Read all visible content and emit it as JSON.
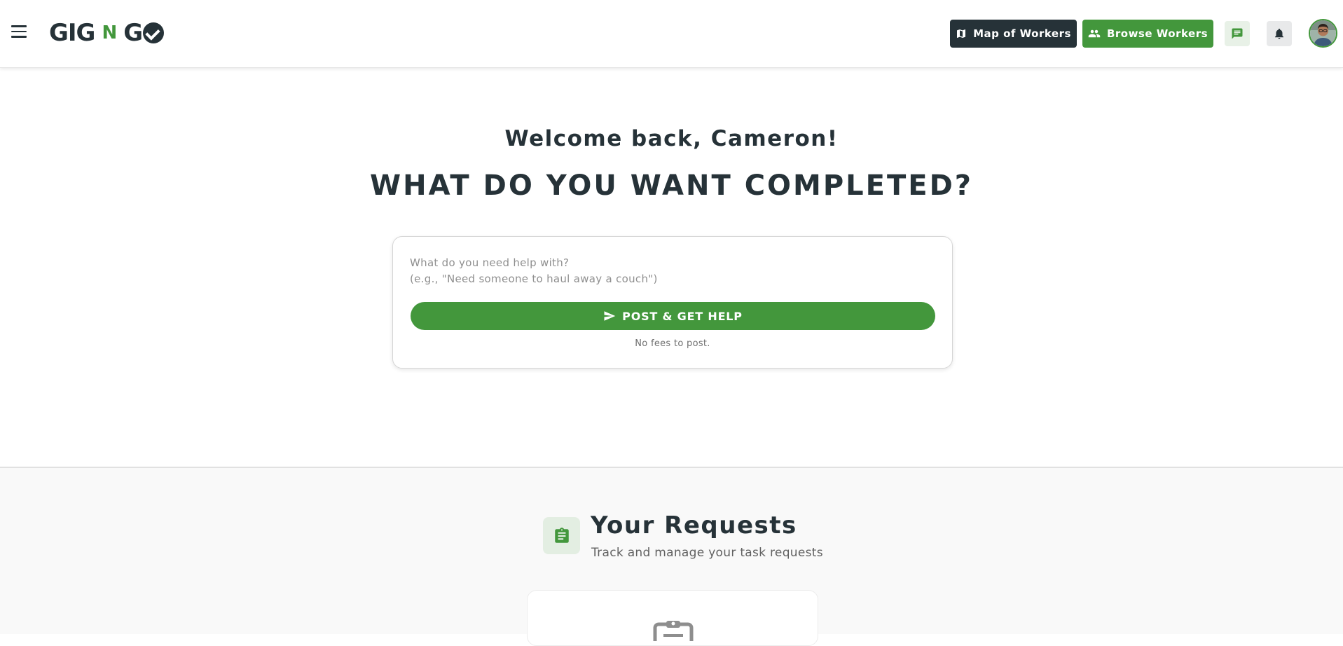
{
  "app": {
    "logo_left": "GIG",
    "logo_mid": "N",
    "logo_right": "G",
    "brand_green": "#43973c",
    "brand_dark": "#263238"
  },
  "header": {
    "map_label": "Map of Workers",
    "browse_label": "Browse Workers",
    "icons": [
      "menu-icon",
      "map-icon",
      "people-icon",
      "chat-icon",
      "bell-icon",
      "avatar"
    ]
  },
  "hero": {
    "welcome": "Welcome back, Cameron!",
    "headline": "WHAT DO YOU WANT COMPLETED?",
    "input_placeholder": "What do you need help with?\n(e.g., \"Need someone to haul away a couch\")",
    "post_label": "POST & GET HELP",
    "fees_note": "No fees to post."
  },
  "requests": {
    "title": "Your Requests",
    "subtitle": "Track and manage your task requests"
  }
}
